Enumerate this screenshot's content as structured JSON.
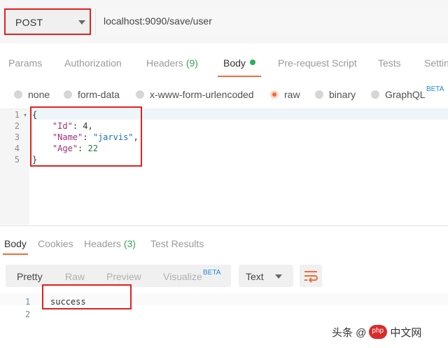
{
  "request": {
    "method": "POST",
    "url": "localhost:9090/save/user"
  },
  "request_tabs": [
    {
      "label": "Params"
    },
    {
      "label": "Authorization"
    },
    {
      "label": "Headers",
      "count": "(9)"
    },
    {
      "label": "Body"
    },
    {
      "label": "Pre-request Script"
    },
    {
      "label": "Tests"
    },
    {
      "label": "Settin"
    }
  ],
  "body_types": [
    {
      "label": "none"
    },
    {
      "label": "form-data"
    },
    {
      "label": "x-www-form-urlencoded"
    },
    {
      "label": "raw"
    },
    {
      "label": "binary"
    },
    {
      "label": "GraphQL",
      "badge": "BETA"
    }
  ],
  "selected_body_type": "raw",
  "editor": {
    "line_numbers": [
      "1",
      "2",
      "3",
      "4",
      "5"
    ],
    "lines": {
      "l1": "{",
      "l2_key": "\"Id\"",
      "l2_rest": ": 4,",
      "l3_key": "\"Name\"",
      "l3_sep": ": ",
      "l3_val": "\"jarvis\"",
      "l3_end": ",",
      "l4_key": "\"Age\"",
      "l4_sep": ": ",
      "l4_val": "22",
      "l5": "}"
    }
  },
  "response_tabs": [
    {
      "label": "Body"
    },
    {
      "label": "Cookies"
    },
    {
      "label": "Headers",
      "count": "(3)"
    },
    {
      "label": "Test Results"
    }
  ],
  "view_modes": [
    {
      "label": "Pretty"
    },
    {
      "label": "Raw"
    },
    {
      "label": "Preview"
    },
    {
      "label": "Visualize",
      "badge": "BETA"
    }
  ],
  "format": "Text",
  "response": {
    "line_numbers": [
      "1",
      "2"
    ],
    "line1": "success"
  },
  "watermark": {
    "prefix": "头条 @",
    "logo": "php",
    "suffix": "中文网"
  },
  "colors": {
    "accent": "#f26b3a",
    "highlight_box": "#e0221e",
    "success_green": "#2bb058"
  },
  "icons": {
    "wrap": "wrap-lines-icon",
    "caret": "chevron-down-icon"
  }
}
